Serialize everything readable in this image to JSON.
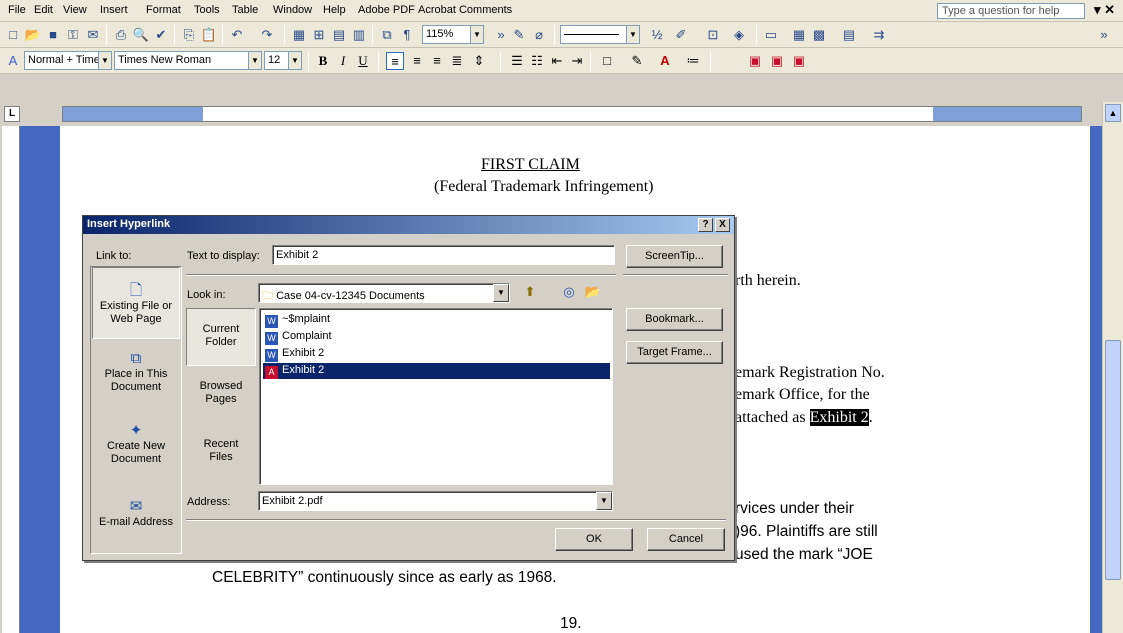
{
  "menu": [
    "File",
    "Edit",
    "View",
    "Insert",
    "Format",
    "Tools",
    "Table",
    "Window",
    "Help",
    "Adobe PDF",
    "Acrobat Comments"
  ],
  "help_placeholder": "Type a question for help",
  "toolbar": {
    "zoom": "115%",
    "style": "Normal + Times",
    "font": "Times New Roman",
    "size": "12",
    "bold": "B",
    "italic": "I",
    "underline": "U",
    "pilcrow": "¶"
  },
  "document": {
    "heading": "FIRST CLAIM",
    "subheading": "(Federal Trademark Infringement)",
    "line1": "rth herein.",
    "line2": "emark Registration No.",
    "line3": "emark Office, for the",
    "line4_pre": "attached as ",
    "line4_highlight": "Exhibit 2",
    "line4_post": ".",
    "line5": "rvices under their",
    "line6": ")96.  Plaintiffs are still",
    "line7": "used the mark “JOE",
    "line8": "CELEBRITY” continuously since as early as 1968.",
    "page_number": "19."
  },
  "dialog": {
    "title": "Insert Hyperlink",
    "help_btn": "?",
    "close_btn": "X",
    "link_to_label": "Link to:",
    "text_to_display_label": "Text to display:",
    "text_to_display": "Exhibit 2",
    "screentip": "ScreenTip...",
    "look_in_label": "Look in:",
    "look_in": "Case 04-cv-12345 Documents",
    "bookmark": "Bookmark...",
    "target_frame": "Target Frame...",
    "link_items": [
      {
        "label": "Existing File or Web Page"
      },
      {
        "label": "Place in This Document"
      },
      {
        "label": "Create New Document"
      },
      {
        "label": "E-mail Address"
      }
    ],
    "subnav": [
      {
        "label": "Current Folder"
      },
      {
        "label": "Browsed Pages"
      },
      {
        "label": "Recent Files"
      }
    ],
    "files": [
      {
        "name": "~$mplaint",
        "type": "word"
      },
      {
        "name": "Complaint",
        "type": "word"
      },
      {
        "name": "Exhibit 2",
        "type": "word"
      },
      {
        "name": "Exhibit 2",
        "type": "pdf"
      }
    ],
    "address_label": "Address:",
    "address": "Exhibit 2.pdf",
    "ok": "OK",
    "cancel": "Cancel"
  }
}
